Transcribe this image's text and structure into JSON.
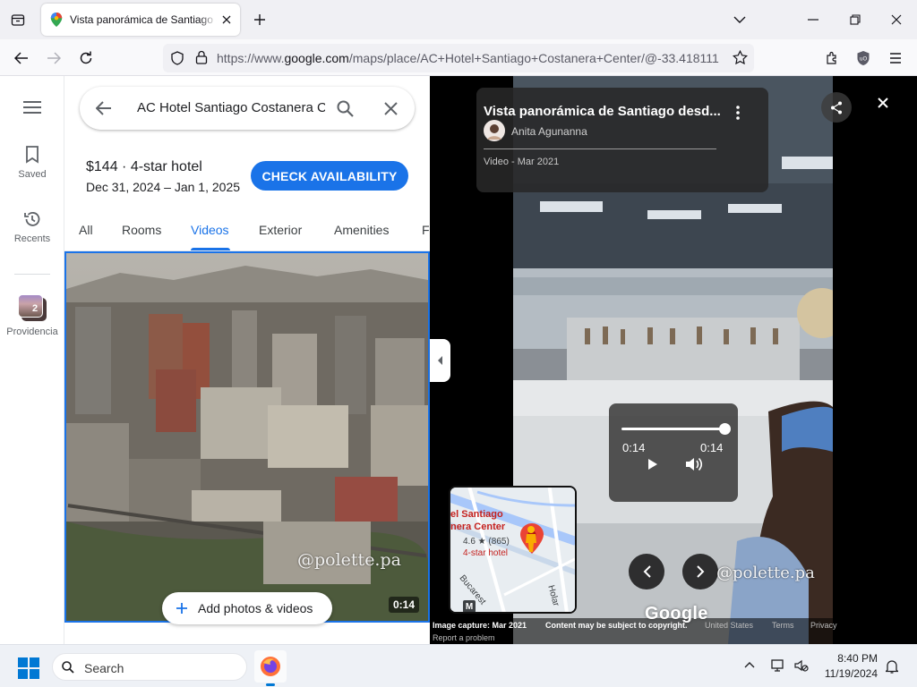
{
  "browser": {
    "tab_title": "Vista panorámica de Santiago desde",
    "url_prefix": "https://www.",
    "url_domain": "google.com",
    "url_rest": "/maps/place/AC+Hotel+Santiago+Costanera+Center/@-33.418111"
  },
  "rail": {
    "saved_label": "Saved",
    "recents_label": "Recents",
    "recent_place_label": "Providencia",
    "recent_place_count": "2"
  },
  "place": {
    "search_value": "AC Hotel Santiago Costanera Center",
    "price_line": "$144 · 4-star hotel",
    "dates": "Dec 31, 2024 – Jan 1, 2025",
    "check_availability": "CHECK AVAILABILITY",
    "tabs": [
      "All",
      "Rooms",
      "Videos",
      "Exterior",
      "Amenities",
      "Fo"
    ],
    "active_tab": "Videos",
    "add_media_label": "Add photos & videos",
    "video_duration": "0:14",
    "watermark": "@polette.pa"
  },
  "viewer": {
    "title": "Vista panorámica de Santiago desd...",
    "author": "Anita Agunanna",
    "meta": "Video - Mar 2021",
    "time_current": "0:14",
    "time_total": "0:14",
    "progress": 1.0,
    "watermark": "@polette.pa",
    "google_logo": "Google",
    "image_capture": "Image capture: Mar 2021",
    "copyright": "Content may be subject to copyright.",
    "country": "United States",
    "terms": "Terms",
    "privacy": "Privacy",
    "report": "Report a problem",
    "minimap": {
      "place_name_1": "el Santiago",
      "place_name_2": "nera Center",
      "rating": "4.6 ★ (865)",
      "category": "4-star hotel",
      "street_1": "Bucarest",
      "street_2": "Holar",
      "metro": "M"
    }
  },
  "taskbar": {
    "search_placeholder": "Search",
    "time": "8:40 PM",
    "date": "11/19/2024"
  },
  "colors": {
    "accent": "#1a73e8",
    "map_pin": "#ea4335",
    "viewer_bg": "#000000"
  }
}
